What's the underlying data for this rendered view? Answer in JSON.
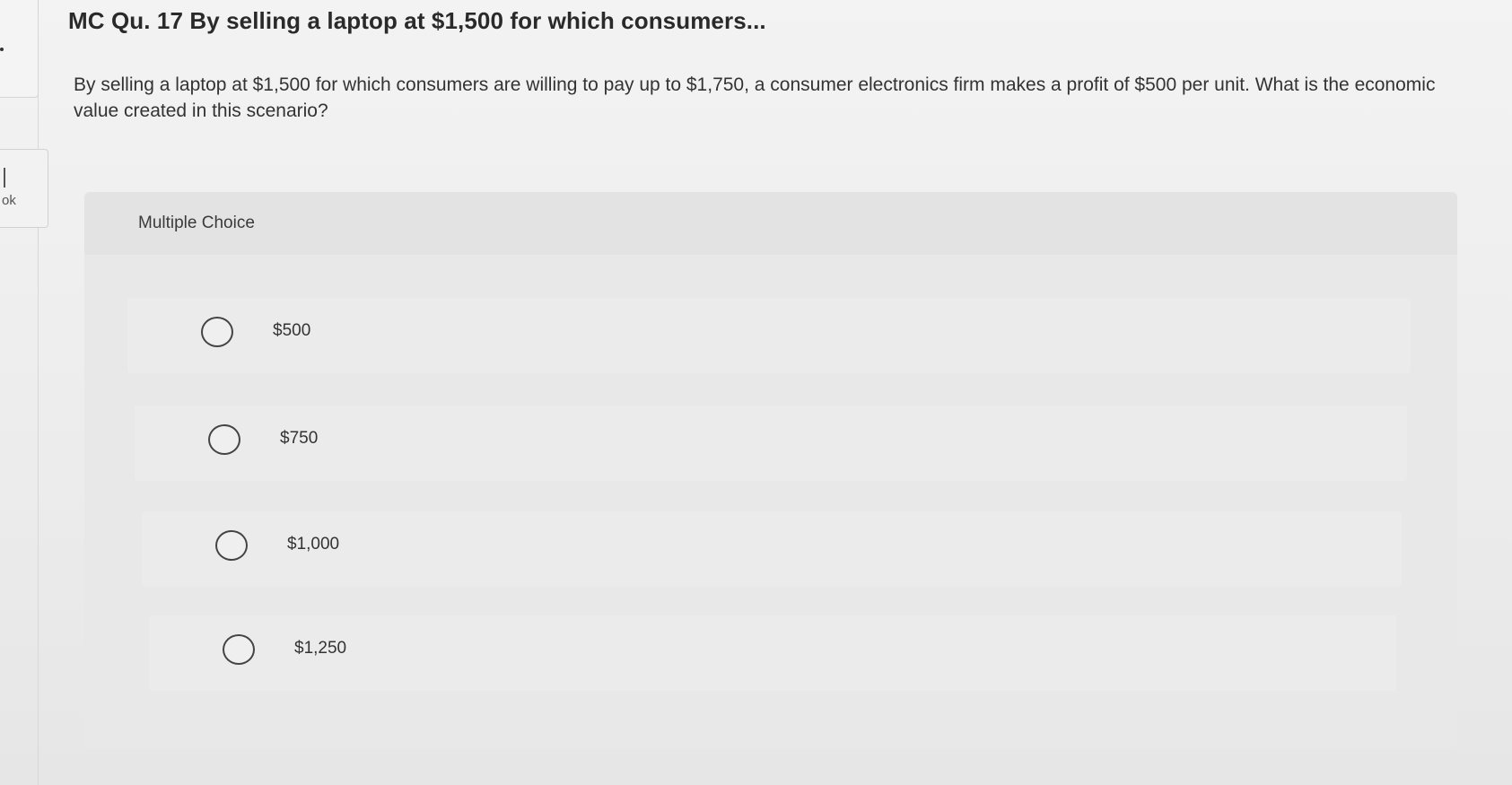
{
  "sidebar": {
    "ebook_label": "ok"
  },
  "question": {
    "title": "MC Qu. 17 By selling a laptop at $1,500 for which consumers...",
    "prompt": "By selling a laptop at $1,500 for which consumers are willing to pay up to $1,750, a consumer electronics firm makes a profit of $500 per unit. What is the economic value created in this scenario?"
  },
  "choices": {
    "header": "Multiple Choice",
    "options": [
      {
        "label": "$500",
        "selected": false
      },
      {
        "label": "$750",
        "selected": false
      },
      {
        "label": "$1,000",
        "selected": false
      },
      {
        "label": "$1,250",
        "selected": false
      }
    ]
  }
}
